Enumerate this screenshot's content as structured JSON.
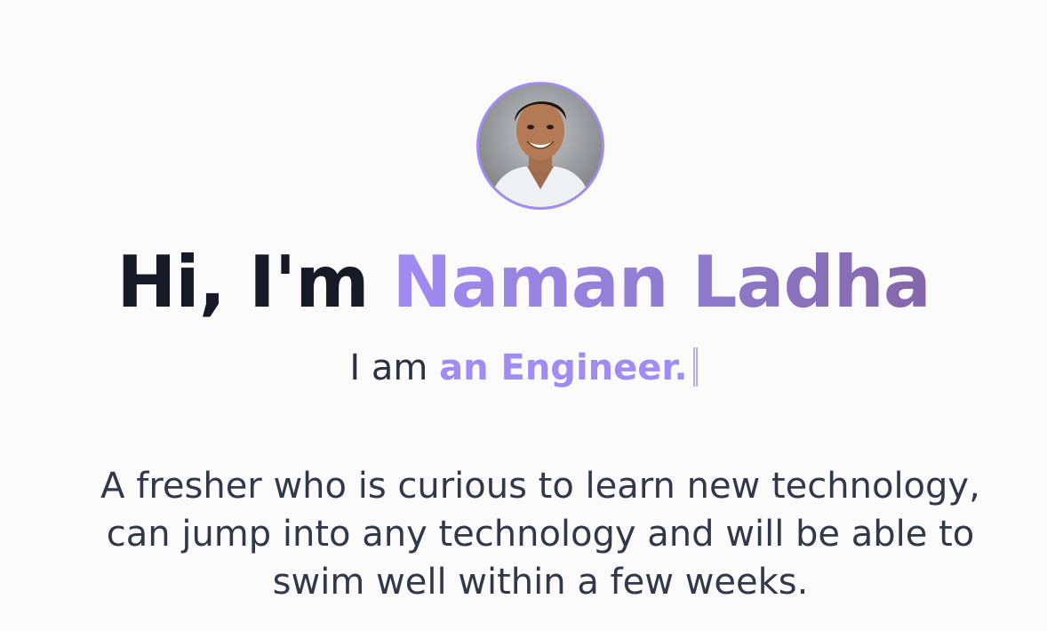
{
  "hero": {
    "greeting": "Hi, I'm",
    "name": "Naman Ladha",
    "role_prefix": "I am",
    "role": "an Engineer.",
    "bio": "A fresher who is curious to learn new technology, can jump into any technology and will be able to swim well within a few weeks."
  },
  "colors": {
    "background": "#fbfbfc",
    "heading": "#151a26",
    "accent": "#9f8cf4",
    "accent_dark": "#8466a8",
    "body_text": "#323848"
  },
  "icons": {
    "avatar": "profile-photo",
    "cursor": "typing-cursor"
  }
}
